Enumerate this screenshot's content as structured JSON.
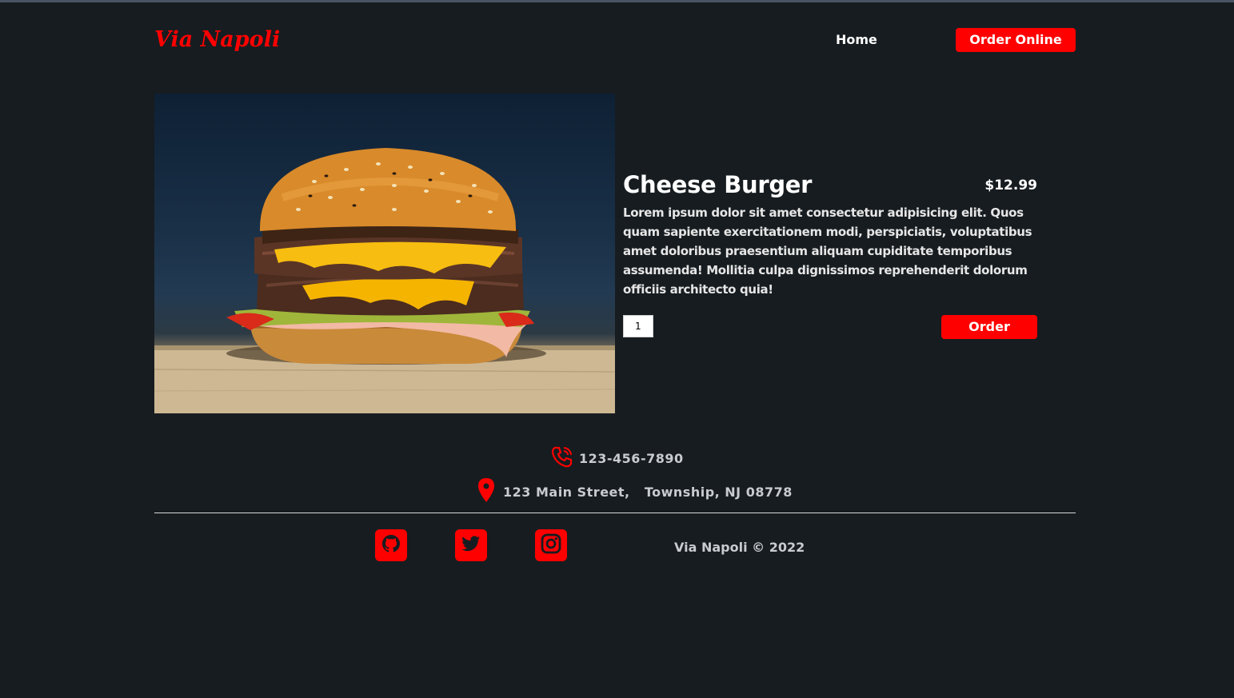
{
  "header": {
    "logo": "Via Napoli",
    "nav_home": "Home",
    "nav_order_online": "Order Online"
  },
  "product": {
    "name": "Cheese Burger",
    "price": "$12.99",
    "description": "Lorem ipsum dolor sit amet consectetur adipisicing elit. Quos quam sapiente exercitationem modi, perspiciatis, voluptatibus amet doloribus praesentium aliquam cupiditate temporibus assumenda! Mollitia culpa dignissimos reprehenderit dolorum officiis architecto quia!",
    "quantity": "1",
    "order_label": "Order"
  },
  "footer": {
    "phone": "123-456-7890",
    "address": "123 Main Street,   Township, NJ 08778",
    "copyright": "Via Napoli © 2022",
    "social": [
      {
        "icon": "github-icon"
      },
      {
        "icon": "twitter-icon"
      },
      {
        "icon": "instagram-icon"
      }
    ]
  },
  "colors": {
    "accent": "#ff0000",
    "background": "#171c20",
    "text": "#ffffff",
    "muted_text": "#c8cbcf"
  }
}
